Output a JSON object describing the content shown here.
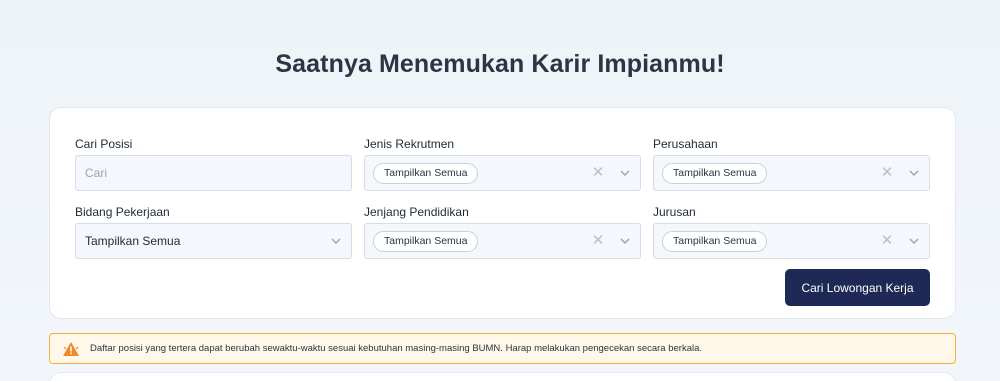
{
  "page": {
    "title": "Saatnya Menemukan Karir Impianmu!"
  },
  "filters": {
    "position": {
      "label": "Cari Posisi",
      "placeholder": "Cari",
      "value": ""
    },
    "recruitment_type": {
      "label": "Jenis Rekrutmen",
      "selected": "Tampilkan Semua"
    },
    "company": {
      "label": "Perusahaan",
      "selected": "Tampilkan Semua"
    },
    "job_field": {
      "label": "Bidang Pekerjaan",
      "selected": "Tampilkan Semua"
    },
    "education_level": {
      "label": "Jenjang Pendidikan",
      "selected": "Tampilkan Semua"
    },
    "major": {
      "label": "Jurusan",
      "selected": "Tampilkan Semua"
    }
  },
  "actions": {
    "search_label": "Cari Lowongan Kerja"
  },
  "notice": {
    "icon": "warning-icon",
    "text": "Daftar posisi yang tertera dapat berubah sewaktu-waktu sesuai kebutuhan masing-masing BUMN. Harap melakukan pengecekan secara berkala."
  },
  "colors": {
    "primary_button": "#1e2a55",
    "notice_border": "#f0b23c",
    "notice_background": "#fff7e8",
    "warning_icon": "#f08a24"
  }
}
